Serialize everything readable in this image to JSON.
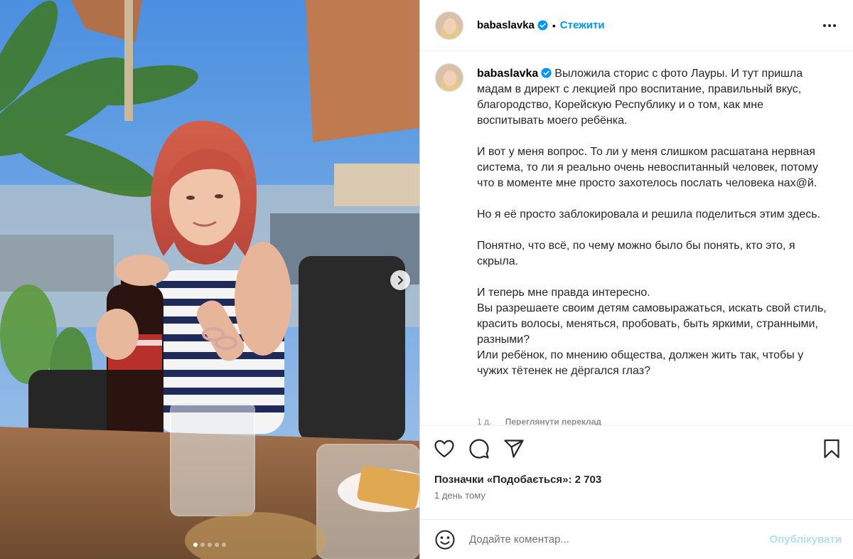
{
  "post": {
    "username": "babaslavka",
    "follow_label": "Стежити",
    "separator": "•",
    "caption": "Выложила сторис с фото Лауры. И тут пришла мадам в директ с лекцией про воспитание, правильный вкус, благородство, Корейскую Республику и о том, как мне воспитывать моего ребёнка.\n\nИ вот у меня вопрос. То ли у меня слишком расшатана нервная система, то ли я реально очень невоспитанный человек, потому что в моменте мне просто захотелось послать человека нах@й.\n\nНо я её просто заблокировала и решила поделиться этим здесь.\n\nПонятно, что всё, по чему можно было бы понять, кто это, я скрыла.\n\nИ теперь мне правда интересно.\nВы разрешаете своим детям самовыражаться, искать свой стиль, красить волосы, меняться, пробовать, быть яркими, странными, разными?\nИли ребёнок, по мнению общества, должен жить так, чтобы у чужих тётенек не дёргался глаз?",
    "caption_age": "1 д.",
    "see_translation": "Переглянути переклад",
    "likes_text": "Позначки «Подобається»: 2 703",
    "time_ago": "1 день тому",
    "comment_placeholder": "Додайте коментар...",
    "post_button": "Опублікувати"
  },
  "carousel": {
    "slide_count": 5,
    "active_index": 0
  },
  "icons": {
    "verified": "verified-badge-icon",
    "more": "more-options-icon",
    "like": "heart-icon",
    "comment": "comment-icon",
    "share": "share-icon",
    "save": "bookmark-icon",
    "emoji": "emoji-icon",
    "next": "chevron-right-icon"
  },
  "colors": {
    "accent": "#0095f6",
    "verified": "#0095f6",
    "post_disabled": "#b2dffc"
  }
}
